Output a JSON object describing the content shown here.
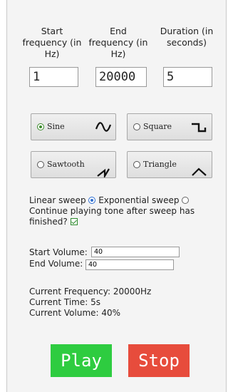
{
  "headers": {
    "start": "Start frequency (in Hz)",
    "end": "End frequency (in Hz)",
    "duration": "Duration (in seconds)"
  },
  "inputs": {
    "start_value": "1",
    "end_value": "20000",
    "duration_value": "5"
  },
  "waves": [
    {
      "label": "Sine",
      "selected": true,
      "icon": "sine-wave-icon"
    },
    {
      "label": "Square",
      "selected": false,
      "icon": "square-wave-icon"
    },
    {
      "label": "Sawtooth",
      "selected": false,
      "icon": "sawtooth-wave-icon"
    },
    {
      "label": "Triangle",
      "selected": false,
      "icon": "triangle-wave-icon"
    }
  ],
  "sweep": {
    "linear_label": "Linear sweep",
    "linear_selected": true,
    "exponential_label": "Exponential sweep",
    "exponential_selected": false,
    "continue_label": "Continue playing tone after sweep has finished?",
    "continue_checked": true
  },
  "volume": {
    "start_label": "Start Volume:",
    "start_value": "40",
    "end_label": "End Volume:",
    "end_value": "40"
  },
  "status": {
    "frequency": "Current Frequency: 20000Hz",
    "time": "Current Time: 5s",
    "volume": "Current Volume: 40%"
  },
  "buttons": {
    "play": "Play",
    "stop": "Stop"
  },
  "colors": {
    "play": "#2ecc40",
    "stop": "#e74c3c"
  }
}
